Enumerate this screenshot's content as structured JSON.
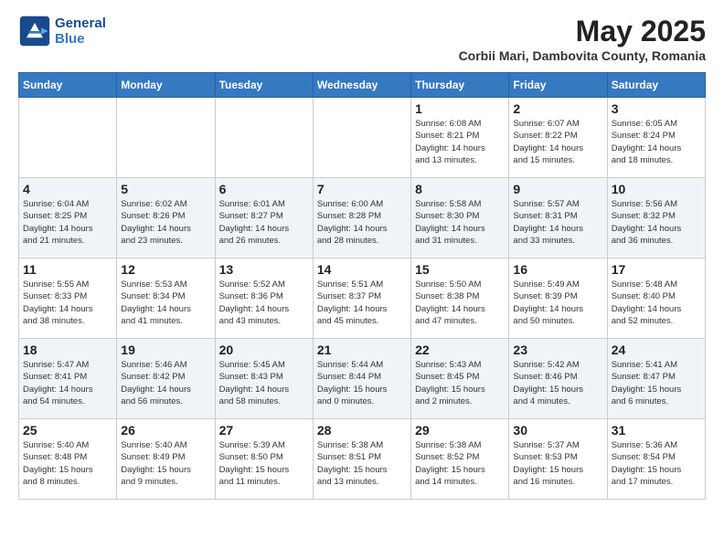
{
  "header": {
    "logo_line1": "General",
    "logo_line2": "Blue",
    "main_title": "May 2025",
    "subtitle": "Corbii Mari, Dambovita County, Romania"
  },
  "days_of_week": [
    "Sunday",
    "Monday",
    "Tuesday",
    "Wednesday",
    "Thursday",
    "Friday",
    "Saturday"
  ],
  "weeks": [
    [
      {
        "day": "",
        "info": ""
      },
      {
        "day": "",
        "info": ""
      },
      {
        "day": "",
        "info": ""
      },
      {
        "day": "",
        "info": ""
      },
      {
        "day": "1",
        "info": "Sunrise: 6:08 AM\nSunset: 8:21 PM\nDaylight: 14 hours\nand 13 minutes."
      },
      {
        "day": "2",
        "info": "Sunrise: 6:07 AM\nSunset: 8:22 PM\nDaylight: 14 hours\nand 15 minutes."
      },
      {
        "day": "3",
        "info": "Sunrise: 6:05 AM\nSunset: 8:24 PM\nDaylight: 14 hours\nand 18 minutes."
      }
    ],
    [
      {
        "day": "4",
        "info": "Sunrise: 6:04 AM\nSunset: 8:25 PM\nDaylight: 14 hours\nand 21 minutes."
      },
      {
        "day": "5",
        "info": "Sunrise: 6:02 AM\nSunset: 8:26 PM\nDaylight: 14 hours\nand 23 minutes."
      },
      {
        "day": "6",
        "info": "Sunrise: 6:01 AM\nSunset: 8:27 PM\nDaylight: 14 hours\nand 26 minutes."
      },
      {
        "day": "7",
        "info": "Sunrise: 6:00 AM\nSunset: 8:28 PM\nDaylight: 14 hours\nand 28 minutes."
      },
      {
        "day": "8",
        "info": "Sunrise: 5:58 AM\nSunset: 8:30 PM\nDaylight: 14 hours\nand 31 minutes."
      },
      {
        "day": "9",
        "info": "Sunrise: 5:57 AM\nSunset: 8:31 PM\nDaylight: 14 hours\nand 33 minutes."
      },
      {
        "day": "10",
        "info": "Sunrise: 5:56 AM\nSunset: 8:32 PM\nDaylight: 14 hours\nand 36 minutes."
      }
    ],
    [
      {
        "day": "11",
        "info": "Sunrise: 5:55 AM\nSunset: 8:33 PM\nDaylight: 14 hours\nand 38 minutes."
      },
      {
        "day": "12",
        "info": "Sunrise: 5:53 AM\nSunset: 8:34 PM\nDaylight: 14 hours\nand 41 minutes."
      },
      {
        "day": "13",
        "info": "Sunrise: 5:52 AM\nSunset: 8:36 PM\nDaylight: 14 hours\nand 43 minutes."
      },
      {
        "day": "14",
        "info": "Sunrise: 5:51 AM\nSunset: 8:37 PM\nDaylight: 14 hours\nand 45 minutes."
      },
      {
        "day": "15",
        "info": "Sunrise: 5:50 AM\nSunset: 8:38 PM\nDaylight: 14 hours\nand 47 minutes."
      },
      {
        "day": "16",
        "info": "Sunrise: 5:49 AM\nSunset: 8:39 PM\nDaylight: 14 hours\nand 50 minutes."
      },
      {
        "day": "17",
        "info": "Sunrise: 5:48 AM\nSunset: 8:40 PM\nDaylight: 14 hours\nand 52 minutes."
      }
    ],
    [
      {
        "day": "18",
        "info": "Sunrise: 5:47 AM\nSunset: 8:41 PM\nDaylight: 14 hours\nand 54 minutes."
      },
      {
        "day": "19",
        "info": "Sunrise: 5:46 AM\nSunset: 8:42 PM\nDaylight: 14 hours\nand 56 minutes."
      },
      {
        "day": "20",
        "info": "Sunrise: 5:45 AM\nSunset: 8:43 PM\nDaylight: 14 hours\nand 58 minutes."
      },
      {
        "day": "21",
        "info": "Sunrise: 5:44 AM\nSunset: 8:44 PM\nDaylight: 15 hours\nand 0 minutes."
      },
      {
        "day": "22",
        "info": "Sunrise: 5:43 AM\nSunset: 8:45 PM\nDaylight: 15 hours\nand 2 minutes."
      },
      {
        "day": "23",
        "info": "Sunrise: 5:42 AM\nSunset: 8:46 PM\nDaylight: 15 hours\nand 4 minutes."
      },
      {
        "day": "24",
        "info": "Sunrise: 5:41 AM\nSunset: 8:47 PM\nDaylight: 15 hours\nand 6 minutes."
      }
    ],
    [
      {
        "day": "25",
        "info": "Sunrise: 5:40 AM\nSunset: 8:48 PM\nDaylight: 15 hours\nand 8 minutes."
      },
      {
        "day": "26",
        "info": "Sunrise: 5:40 AM\nSunset: 8:49 PM\nDaylight: 15 hours\nand 9 minutes."
      },
      {
        "day": "27",
        "info": "Sunrise: 5:39 AM\nSunset: 8:50 PM\nDaylight: 15 hours\nand 11 minutes."
      },
      {
        "day": "28",
        "info": "Sunrise: 5:38 AM\nSunset: 8:51 PM\nDaylight: 15 hours\nand 13 minutes."
      },
      {
        "day": "29",
        "info": "Sunrise: 5:38 AM\nSunset: 8:52 PM\nDaylight: 15 hours\nand 14 minutes."
      },
      {
        "day": "30",
        "info": "Sunrise: 5:37 AM\nSunset: 8:53 PM\nDaylight: 15 hours\nand 16 minutes."
      },
      {
        "day": "31",
        "info": "Sunrise: 5:36 AM\nSunset: 8:54 PM\nDaylight: 15 hours\nand 17 minutes."
      }
    ]
  ]
}
